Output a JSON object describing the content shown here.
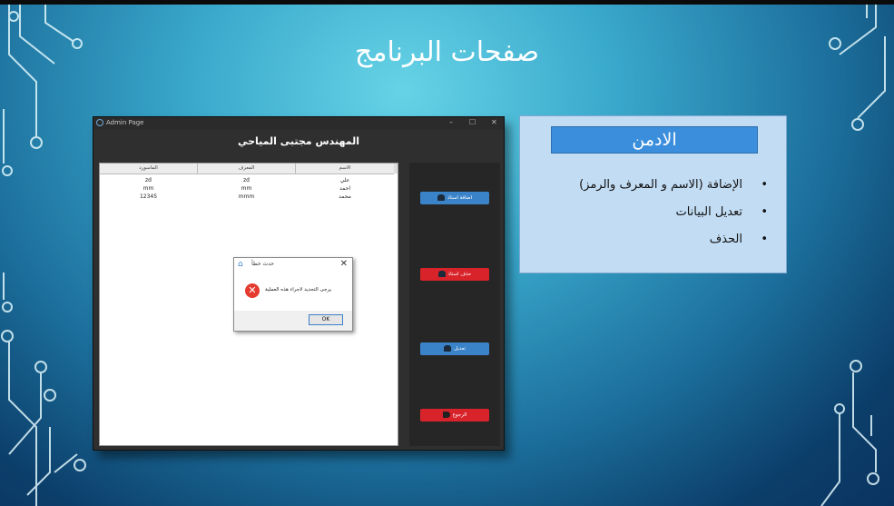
{
  "slide": {
    "title": "صفحات البرنامج"
  },
  "window": {
    "title": "Admin Page",
    "controls": {
      "minimize": "–",
      "maximize": "☐",
      "close": "✕"
    },
    "header": "المهندس مجتبى المياحي",
    "table": {
      "columns": [
        "الاسم",
        "المعرف",
        "الماسورد"
      ],
      "rows": [
        [
          "علي",
          "zd",
          "zd"
        ],
        [
          "احمد",
          "mm",
          "mm"
        ],
        [
          "محمد",
          "mmm",
          "12345"
        ]
      ]
    },
    "buttons": {
      "add": "اضافة استاذ",
      "delete": "حذف استاذ",
      "edit": "تعديل",
      "back": "الرجوع"
    },
    "message_box": {
      "title": "حدث خطأ",
      "text": "يرجى التحديد لاجراء هذه العملية",
      "ok": "OK"
    }
  },
  "info_panel": {
    "title": "الادمن",
    "items": [
      "الإضافة (الاسم و المعرف والرمز)",
      "تعديل البيانات",
      "الحذف"
    ]
  },
  "colors": {
    "accent_blue": "#3b83c9",
    "danger_red": "#d8232a",
    "panel_bg": "#c2dcf3"
  }
}
